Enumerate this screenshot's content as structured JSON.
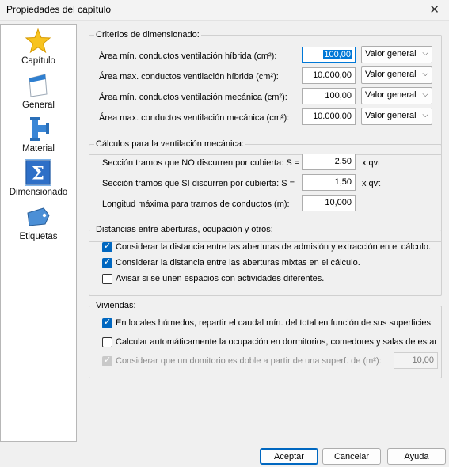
{
  "window": {
    "title": "Propiedades del capítulo",
    "close_glyph": "✕"
  },
  "sidebar": {
    "items": [
      {
        "label": "Capítulo",
        "icon": "star-icon"
      },
      {
        "label": "General",
        "icon": "page-icon"
      },
      {
        "label": "Material",
        "icon": "pipe-icon"
      },
      {
        "label": "Dimensionado",
        "icon": "sigma-icon",
        "active": true
      },
      {
        "label": "Etiquetas",
        "icon": "tag-icon"
      }
    ]
  },
  "criterios": {
    "title": "Criterios de dimensionado:",
    "rows": [
      {
        "label": "Área mín. conductos ventilación híbrida  (cm²):",
        "value": "100,00",
        "option": "Valor general"
      },
      {
        "label": "Área max. conductos ventilación híbrida  (cm²):",
        "value": "10.000,00",
        "option": "Valor general"
      },
      {
        "label": "Área mín. conductos ventilación mecánica  (cm²):",
        "value": "100,00",
        "option": "Valor general"
      },
      {
        "label": "Área max. conductos ventilación mecánica  (cm²):",
        "value": "10.000,00",
        "option": "Valor general"
      }
    ]
  },
  "calculos": {
    "title": "Cálculos para la ventilación mecánica:",
    "row1": {
      "label": "Sección tramos que NO discurren por cubierta:  S =",
      "value": "2,50",
      "unit": "x qvt"
    },
    "row2": {
      "label": "Sección tramos que SI discurren por cubierta:   S =",
      "value": "1,50",
      "unit": "x qvt"
    },
    "row3": {
      "label": "Longitud máxima para tramos de conductos (m):",
      "value": "10,000"
    }
  },
  "distancias": {
    "title": "Distancias entre aberturas, ocupación y otros:",
    "checks": [
      {
        "label": "Considerar la distancia entre las aberturas de admisión y extracción en el cálculo.",
        "checked": true
      },
      {
        "label": "Considerar la distancia entre las aberturas mixtas en el cálculo.",
        "checked": true
      },
      {
        "label": "Avisar si se unen espacios con actividades diferentes.",
        "checked": false
      }
    ]
  },
  "viviendas": {
    "title": "Viviendas:",
    "checks": [
      {
        "label": "En locales húmedos, repartir el caudal mín. del total en función de sus superficies",
        "checked": true
      },
      {
        "label": "Calcular automáticamente la ocupación en dormitorios, comedores y salas de estar",
        "checked": false
      },
      {
        "label": "Considerar que un domitorio es doble a partir de una superf. de (m²):",
        "checked": true,
        "disabled": true
      }
    ],
    "superficie_value": "10,00"
  },
  "buttons": {
    "accept": "Aceptar",
    "cancel": "Cancelar",
    "help": "Ayuda"
  },
  "select_chevron": "⌵"
}
